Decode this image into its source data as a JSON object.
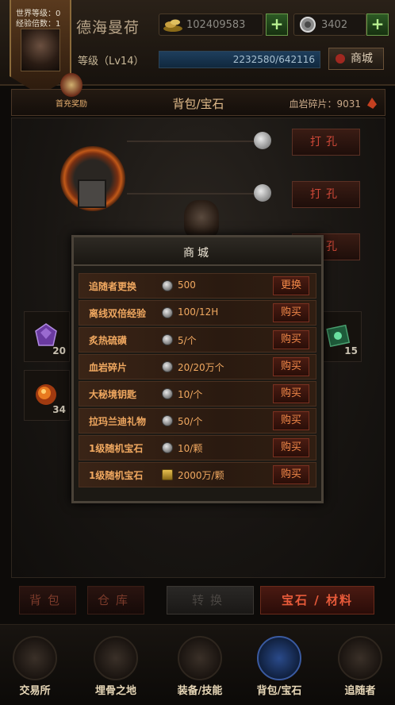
{
  "header": {
    "world_level": "世界等级：0",
    "exp_multiplier": "经验倍数：1",
    "player_name": "德海曼荷",
    "level": "等级（Lv14）",
    "gold": "102409583",
    "gems": "3402",
    "plus_label": "+",
    "exp_text": "2232580/642116",
    "exp_fill_fraction": 1,
    "shop_button": "商城",
    "reward_label": "首充奖励"
  },
  "title_bar": {
    "title": "背包/宝石",
    "shard_text": "血岩碎片：9031"
  },
  "socket": {
    "punch_label": "打孔"
  },
  "inventory": [
    {
      "icon": "purple-gem-icon",
      "count": "20"
    },
    {
      "icon": "green-box-icon",
      "count": "15"
    },
    {
      "icon": "fire-orb-icon",
      "count": "34"
    }
  ],
  "shop": {
    "title": "商城",
    "items": [
      {
        "name": "追随者更换",
        "currency": "silver-coin",
        "price": "500",
        "button": "更换"
      },
      {
        "name": "离线双倍经验",
        "currency": "silver-coin",
        "price": "100/12H",
        "button": "购买"
      },
      {
        "name": "炙热硫磺",
        "currency": "silver-coin",
        "price": "5/个",
        "button": "购买"
      },
      {
        "name": "血岩碎片",
        "currency": "silver-coin",
        "price": "20/20万个",
        "button": "购买"
      },
      {
        "name": "大秘境钥匙",
        "currency": "silver-coin",
        "price": "10/个",
        "button": "购买"
      },
      {
        "name": "拉玛兰迪礼物",
        "currency": "silver-coin",
        "price": "50/个",
        "button": "购买"
      },
      {
        "name": "1级随机宝石",
        "currency": "silver-coin",
        "price": "10/颗",
        "button": "购买"
      },
      {
        "name": "1级随机宝石",
        "currency": "gold-coin",
        "price": "2000万/颗",
        "button": "购买"
      }
    ]
  },
  "bag_tabs": {
    "bag": "背包",
    "warehouse": "仓库",
    "convert": "转换",
    "gem_material": "宝石 / 材料"
  },
  "nav": [
    {
      "label": "交易所",
      "icon": "exchange-icon"
    },
    {
      "label": "埋骨之地",
      "icon": "boneyard-icon"
    },
    {
      "label": "装备/技能",
      "icon": "equipment-icon"
    },
    {
      "label": "背包/宝石",
      "icon": "bag-icon"
    },
    {
      "label": "追随者",
      "icon": "follower-icon"
    }
  ]
}
